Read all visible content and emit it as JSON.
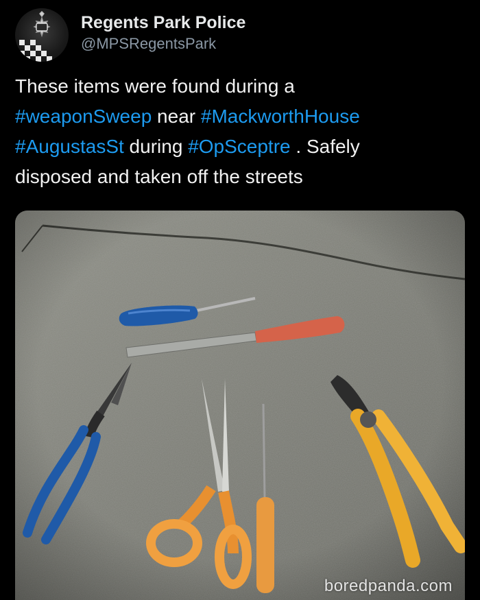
{
  "account": {
    "display_name": "Regents Park Police",
    "handle": "@MPSRegentsPark",
    "avatar_icon": "police-crest-icon"
  },
  "tweet": {
    "text_1": "These items were found during a",
    "tag_1": "#weaponSweep",
    "text_2": " near ",
    "tag_2": "#MackworthHouse",
    "tag_3": "#AugustasSt",
    "text_3": " during ",
    "tag_4": "#OpSceptre",
    "text_4": " . Safely",
    "text_5": "disposed and taken off the streets"
  },
  "media": {
    "watermark": "boredpanda.com"
  },
  "colors": {
    "background": "#000000",
    "text": "#e7e9ea",
    "hashtag": "#1d9bf0",
    "handle": "#8b98a5"
  }
}
